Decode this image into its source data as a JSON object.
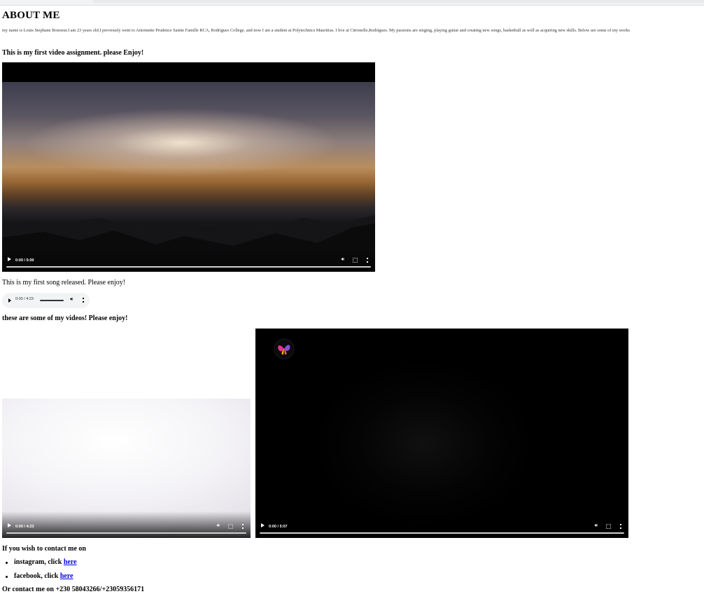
{
  "page": {
    "title": "ABOUT ME",
    "bio": "my name is Louis Stephane Bonoeur.I am 23 years old.I previously went to Antoinette Prudence Sainte Famille RCA, Rodrigues College, and now I am a student at Polytechnics Mauritius. I live at Citronelle,Rodrigues. My passions are singing, playing guitar and creating new songs, basketball as well as acquiring new skills. Below are some of my works"
  },
  "video_section": {
    "heading": "This is my first video assignment. please Enjoy!",
    "video": {
      "time": "0:00 / 5:00",
      "progress": 0,
      "scene": "sunset-over-mountains"
    }
  },
  "song_section": {
    "heading": "This is my first song released. Please enjoy!",
    "audio": {
      "time": "0:00 / 4:23",
      "progress": 0
    }
  },
  "videos_section": {
    "heading": "these are some of my videos! Please enjoy!",
    "videos": [
      {
        "time": "0:00 / 4:23",
        "progress": 0,
        "scene": "bright-white-sky"
      },
      {
        "time": "0:00 / 5:07",
        "progress": 0,
        "scene": "dark-scene-with-logo"
      }
    ]
  },
  "contact": {
    "intro": "If you wish to contact me on",
    "items": [
      {
        "prefix": "instagram, click ",
        "link_text": "here"
      },
      {
        "prefix": "facebook, click ",
        "link_text": "here"
      }
    ],
    "phone_line": "Or contact me on +230 58043266/+23059356171"
  },
  "colors": {
    "link": "#0000ee",
    "audio_bg": "#f1f3f4",
    "video_bg": "#000000"
  },
  "icons": [
    "play-icon",
    "volume-icon",
    "fullscreen-icon",
    "more-options-icon"
  ]
}
